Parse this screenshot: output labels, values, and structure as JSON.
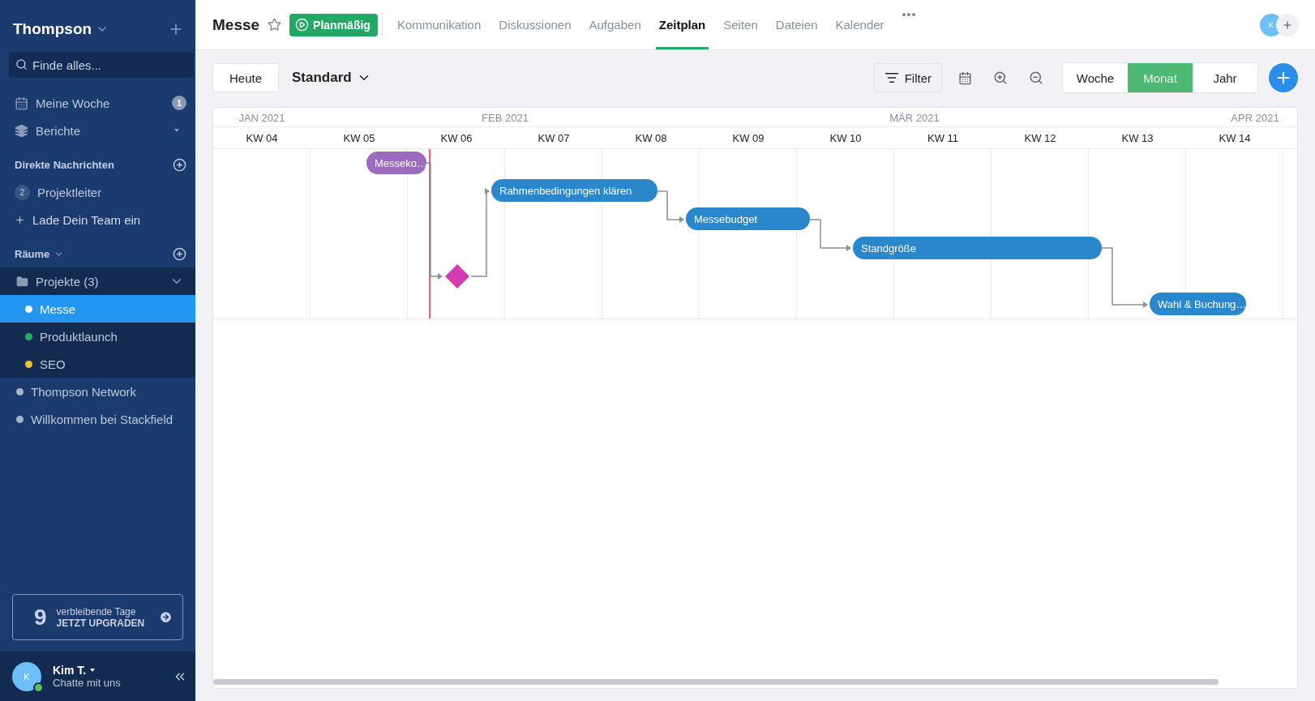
{
  "sidebar": {
    "workspace": "Thompson",
    "search": {
      "placeholder": "Finde alles..."
    },
    "nav": [
      {
        "kind": "calendar",
        "label": "Meine Woche",
        "badge": "1"
      },
      {
        "kind": "layers",
        "label": "Berichte"
      }
    ],
    "direct_messages": {
      "title": "Direkte Nachrichten",
      "items": [
        {
          "count": "2",
          "label": "Projektleiter"
        }
      ],
      "invite": "Lade Dein Team ein"
    },
    "rooms": {
      "title": "Räume",
      "items": [
        {
          "kind": "folder",
          "label": "Projekte (3)",
          "expanded": true,
          "children": [
            {
              "label": "Messe",
              "color": "#ffffff",
              "selected": true
            },
            {
              "label": "Produktlaunch",
              "color": "#27ae60",
              "selected": false
            },
            {
              "label": "SEO",
              "color": "#f0c12c",
              "selected": false
            }
          ]
        },
        {
          "kind": "room",
          "label": "Thompson Network",
          "color": "#a7b3c8",
          "selected": false
        },
        {
          "kind": "room",
          "label": "Willkommen bei Stackfield",
          "color": "#a7b3c8",
          "selected": false
        }
      ]
    },
    "upgrade": {
      "count": "9",
      "line1": "verbleibende Tage",
      "line2": "JETZT UPGRADEN"
    },
    "user": {
      "initial": "K",
      "name": "Kim T.",
      "status": "Chatte mit uns",
      "online": true
    }
  },
  "header": {
    "title": "Messe",
    "status": "Planmäßig",
    "tabs": [
      {
        "label": "Kommunikation",
        "selected": false
      },
      {
        "label": "Diskussionen",
        "selected": false
      },
      {
        "label": "Aufgaben",
        "selected": false
      },
      {
        "label": "Zeitplan",
        "selected": true
      },
      {
        "label": "Seiten",
        "selected": false
      },
      {
        "label": "Dateien",
        "selected": false
      },
      {
        "label": "Kalender",
        "selected": false
      }
    ],
    "avatar_initial": "K"
  },
  "toolbar": {
    "today": "Heute",
    "view": "Standard",
    "filter": "Filter",
    "scales": [
      {
        "label": "Woche",
        "selected": false
      },
      {
        "label": "Monat",
        "selected": true
      },
      {
        "label": "Jahr",
        "selected": false
      }
    ]
  },
  "timeline": {
    "months": [
      "JAN 2021",
      "FEB 2021",
      "MÄR 2021",
      "APR 2021"
    ],
    "weeks": [
      "KW 04",
      "KW 05",
      "KW 06",
      "KW 07",
      "KW 08",
      "KW 09",
      "KW 10",
      "KW 11",
      "KW 12",
      "KW 13",
      "KW 14"
    ],
    "tasks": [
      {
        "kind": "bar",
        "label": "Messeko…",
        "color": "#9b6bc1"
      },
      {
        "kind": "milestone",
        "color": "#d43db2"
      },
      {
        "kind": "bar",
        "label": "Rahmenbedingungen klären",
        "color": "#2a87cc"
      },
      {
        "kind": "bar",
        "label": "Messebudget",
        "color": "#2a87cc"
      },
      {
        "kind": "bar",
        "label": "Standgröße",
        "color": "#2a87cc"
      },
      {
        "kind": "bar",
        "label": "Wahl & Buchung…",
        "color": "#2a87cc"
      }
    ]
  }
}
